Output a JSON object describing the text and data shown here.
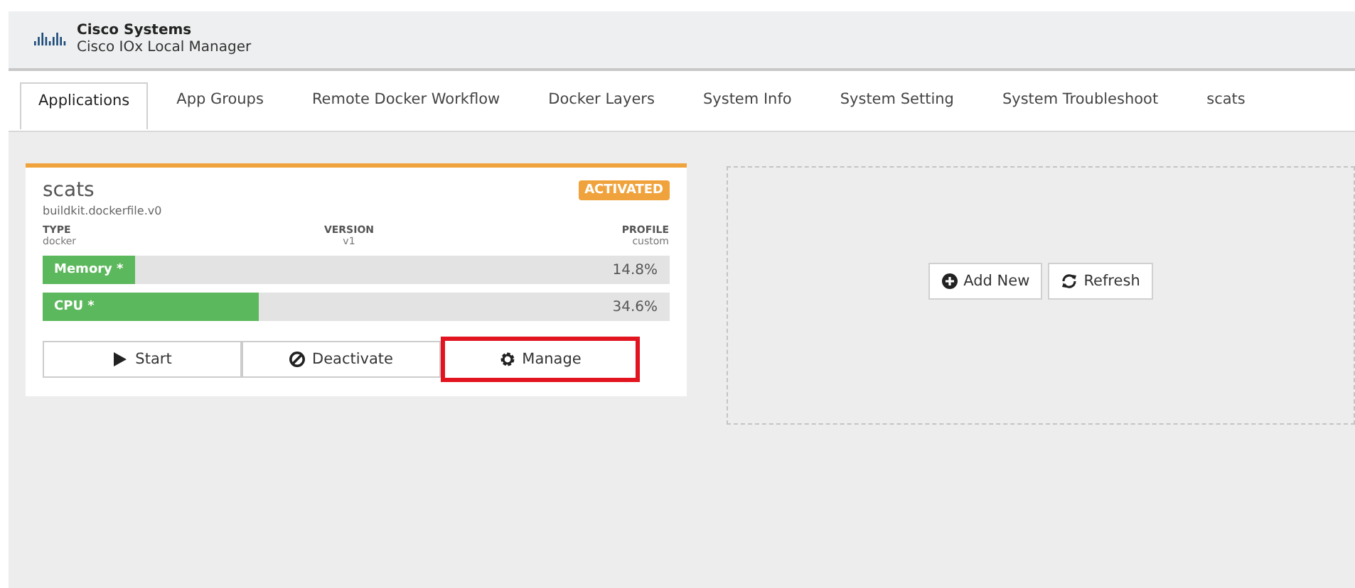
{
  "header": {
    "company": "Cisco Systems",
    "product": "Cisco IOx Local Manager"
  },
  "tabs": [
    {
      "label": "Applications",
      "selected": true
    },
    {
      "label": "App Groups",
      "selected": false
    },
    {
      "label": "Remote Docker Workflow",
      "selected": false
    },
    {
      "label": "Docker Layers",
      "selected": false
    },
    {
      "label": "System Info",
      "selected": false
    },
    {
      "label": "System Setting",
      "selected": false
    },
    {
      "label": "System Troubleshoot",
      "selected": false
    },
    {
      "label": "scats",
      "selected": false
    }
  ],
  "app_card": {
    "name": "scats",
    "status": "ACTIVATED",
    "image": "buildkit.dockerfile.v0",
    "fields": [
      {
        "label": "TYPE",
        "value": "docker"
      },
      {
        "label": "VERSION",
        "value": "v1"
      },
      {
        "label": "PROFILE",
        "value": "custom"
      }
    ],
    "meters": [
      {
        "label": "Memory *",
        "level": 0.148,
        "reading": "14.8%"
      },
      {
        "label": "CPU *",
        "level": 0.346,
        "reading": "34.6%"
      }
    ],
    "actions": [
      {
        "kind": "start",
        "label": "Start",
        "highlighted": false
      },
      {
        "kind": "deactivate",
        "label": "Deactivate",
        "highlighted": false
      },
      {
        "kind": "manage",
        "label": "Manage",
        "highlighted": true
      }
    ]
  },
  "panel_buttons": [
    {
      "kind": "add",
      "label": "Add New"
    },
    {
      "kind": "refresh",
      "label": "Refresh"
    }
  ]
}
